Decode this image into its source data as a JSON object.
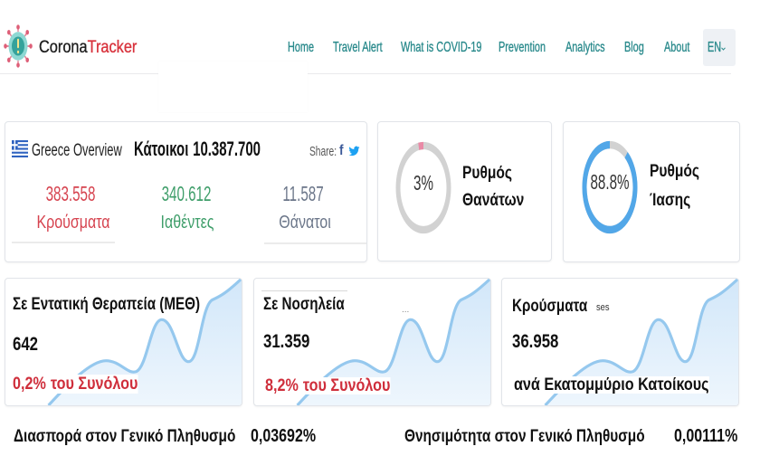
{
  "header": {
    "logo": {
      "icon": "virus-icon",
      "brand_part1": "Corona",
      "brand_part2": "Tracker",
      "brand_part2_color": "#d8323c"
    },
    "nav": [
      {
        "label": "Home"
      },
      {
        "label": "Travel Alert"
      },
      {
        "label": "What is COVID-19"
      },
      {
        "label": "Prevention"
      },
      {
        "label": "Analytics"
      },
      {
        "label": "Blog"
      },
      {
        "label": "About"
      }
    ],
    "nav_color": "#2a8a8c",
    "language": {
      "label": "EN",
      "icon": "chevron-down-icon"
    }
  },
  "overview": {
    "flag_icon": "greece-flag-icon",
    "title": "Greece Overview",
    "population_label": "Κάτοικοι",
    "population": "10.387.700",
    "share_label": "Share:",
    "share_icons": [
      "facebook-icon",
      "twitter-icon"
    ],
    "facebook_glyph": "f",
    "stats": [
      {
        "value": "383.558",
        "label": "Κρούσματα",
        "color": "#d6434f"
      },
      {
        "value": "340.612",
        "label": "Ιαθέντες",
        "color": "#3f9e6a"
      },
      {
        "value": "11.587",
        "label": "Θάνατοι",
        "color": "#6b7689"
      }
    ]
  },
  "rates": [
    {
      "percent_text": "3%",
      "percent": 3,
      "label_line1": "Ρυθμός",
      "label_line2": "Θανάτων",
      "color": "#e98aa6",
      "track_color": "#d2d2d2"
    },
    {
      "percent_text": "88.8%",
      "percent": 88.8,
      "label_line1": "Ρυθμός",
      "label_line2": "Ίασης",
      "color": "#52a7e8",
      "track_color": "#d2d2d2"
    }
  ],
  "cards": [
    {
      "title": "Σε Εντατική Θεραπεία (ΜΕΘ)",
      "value": "642",
      "pct": "0,2%",
      "suffix": "του Συνόλου"
    },
    {
      "title": "Σε Νοσηλεία",
      "extra": "...",
      "value": "31.359",
      "pct": "8,2%",
      "suffix": "του Συνόλου"
    },
    {
      "title": "Κρούσματα",
      "tag": "ses",
      "value": "36.958",
      "subtitle": "ανά Εκατομμύριο Κατοίκους"
    }
  ],
  "footer": {
    "spread_label": "Διασπορά στον Γενικό Πληθυσμό",
    "spread_value": "0,03692%",
    "mortality_label": "Θνησιμότητα στον Γενικό Πληθυσμό",
    "mortality_value": "0,00111%"
  }
}
